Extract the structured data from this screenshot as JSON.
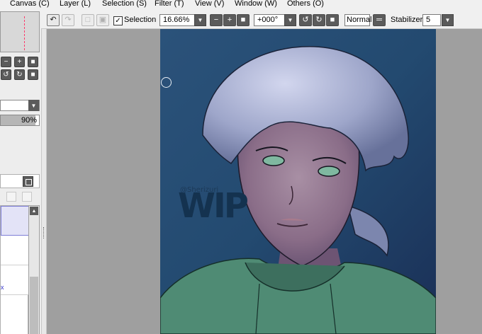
{
  "menubar": {
    "items": [
      "Canvas (C)",
      "Layer (L)",
      "Selection (S)",
      "Filter (T)",
      "View (V)",
      "Window (W)",
      "Others (O)"
    ]
  },
  "toolbar": {
    "undo_icon": "undo-icon",
    "redo_icon": "redo-icon",
    "selection_checked": true,
    "selection_label": "Selection",
    "zoom_value": "16.66%",
    "rotation_value": "+000°",
    "blend_mode_label": "Normal",
    "stabilizer_label": "Stabilizer",
    "stabilizer_value": "5"
  },
  "left_panel": {
    "opacity_value": "90%",
    "opacity_fraction": 0.9
  },
  "canvas": {
    "watermark_text": "WIP",
    "watermark_signature": "@Sherizuri"
  },
  "colors": {
    "canvas_bg": "#9f9f9f",
    "selected_layer": "#e3e3f7",
    "navigator_marker": "#ff3a6a"
  }
}
